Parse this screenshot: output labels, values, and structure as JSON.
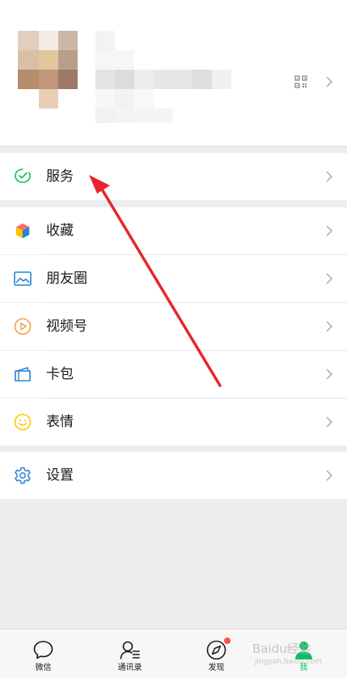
{
  "profile": {
    "qr_icon": "qr-code-icon",
    "chevron_icon": "chevron-right-icon"
  },
  "menu": {
    "services": {
      "label": "服务",
      "icon": "services-icon",
      "icon_color": "#07c160"
    },
    "items": [
      {
        "label": "收藏",
        "icon": "favorites-cube-icon"
      },
      {
        "label": "朋友圈",
        "icon": "moments-image-icon",
        "icon_color": "#2782d7"
      },
      {
        "label": "视频号",
        "icon": "channels-play-icon",
        "icon_color": "#fa9d3b"
      },
      {
        "label": "卡包",
        "icon": "card-wallet-icon",
        "icon_color": "#2782d7"
      },
      {
        "label": "表情",
        "icon": "sticker-smile-icon",
        "icon_color": "#ffc300"
      }
    ],
    "settings": {
      "label": "设置",
      "icon": "settings-gear-icon",
      "icon_color": "#2782d7"
    }
  },
  "tabbar": {
    "tabs": [
      {
        "label": "微信",
        "icon": "chat-bubble-icon"
      },
      {
        "label": "通讯录",
        "icon": "contacts-icon"
      },
      {
        "label": "发现",
        "icon": "discover-compass-icon",
        "badge": true
      },
      {
        "label": "我",
        "icon": "me-person-icon",
        "active": true
      }
    ],
    "active_color": "#07c160",
    "badge_color": "#fa5151"
  },
  "overlay": {
    "annotation": "red-arrow-pointing-to-services",
    "arrow_color": "#e8262a",
    "watermark": "Baidu经验",
    "watermark_sub": "jingyan.baidu.com"
  }
}
